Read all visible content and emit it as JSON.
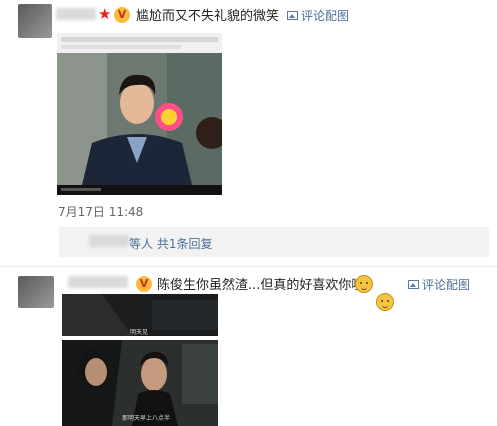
{
  "comment1": {
    "text": "尴尬而又不失礼貌的微笑",
    "view_image_label": "评论配图",
    "time": "7月17日 11:48",
    "reply_summary": "等人 共1条回复",
    "badge_icon": "vip-badge-icon",
    "star_icon": "star-icon"
  },
  "comment2": {
    "text": "陈俊生你虽然渣...但真的好喜欢你噢",
    "view_image_label": "评论配图",
    "emojis": [
      "cat-face-emoji",
      "cat-face-emoji"
    ],
    "subtitles": [
      "明天见",
      "那明天早上八点半"
    ]
  },
  "colors": {
    "link": "#4b6f99",
    "reply_bg": "#f2f2f2"
  }
}
